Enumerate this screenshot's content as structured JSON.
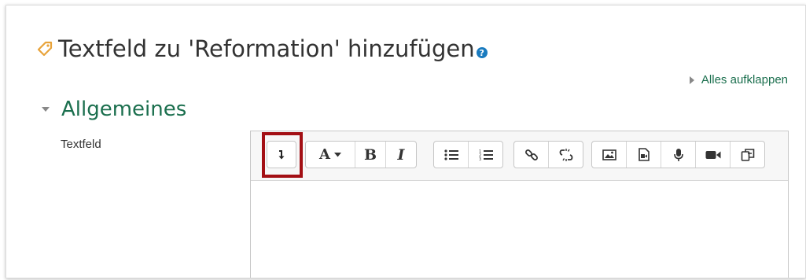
{
  "header": {
    "title": "Textfeld zu 'Reformation' hinzufügen",
    "help_glyph": "?",
    "icon": "tag-icon"
  },
  "expand_all": {
    "label": "Alles aufklappen",
    "icon": "triangle-right-icon"
  },
  "section": {
    "title": "Allgemeines",
    "icon": "triangle-down-icon"
  },
  "field": {
    "label": "Textfeld"
  },
  "editor": {
    "toolbar_groups": [
      [
        "show-more-buttons-icon"
      ],
      [
        "font-style-icon",
        "bold-icon",
        "italic-icon"
      ],
      [
        "unordered-list-icon",
        "ordered-list-icon"
      ],
      [
        "link-icon",
        "unlink-icon"
      ],
      [
        "image-icon",
        "media-icon",
        "record-audio-icon",
        "record-video-icon",
        "manage-files-icon"
      ]
    ],
    "buttons": {
      "font_style": "A",
      "bold": "B",
      "italic": "I"
    },
    "content": ""
  },
  "colors": {
    "accent_green": "#1b6f4e",
    "highlight_red": "#a30f14",
    "help_blue": "#1a7bbf",
    "tag_orange": "#e8a33a"
  }
}
